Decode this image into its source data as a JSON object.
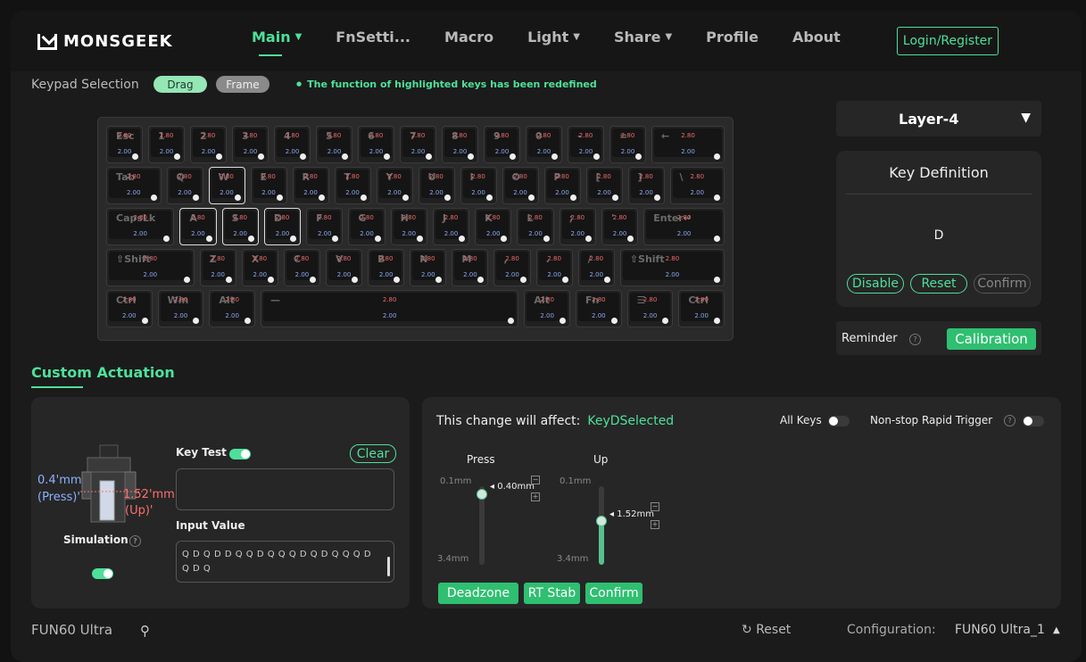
{
  "brand": "MONSGEEK",
  "nav": [
    {
      "label": "Main",
      "active": true,
      "caret": true
    },
    {
      "label": "FnSetti...",
      "active": false,
      "caret": false
    },
    {
      "label": "Macro",
      "active": false,
      "caret": false
    },
    {
      "label": "Light",
      "active": false,
      "caret": true
    },
    {
      "label": "Share",
      "active": false,
      "caret": true
    },
    {
      "label": "Profile",
      "active": false,
      "caret": false
    },
    {
      "label": "About",
      "active": false,
      "caret": false
    }
  ],
  "login_label": "Login/Register",
  "keypad": {
    "label": "Keypad Selection",
    "drag": "Drag",
    "frame": "Frame",
    "notice": "The function of highlighted keys has been redefined"
  },
  "keyboard_rows": [
    [
      {
        "l": "Esc",
        "t": "2.80",
        "b": "2.00"
      },
      {
        "l": "1",
        "t": "2.80",
        "b": "2.00"
      },
      {
        "l": "2",
        "t": "2.80",
        "b": "2.00"
      },
      {
        "l": "3",
        "t": "2.80",
        "b": "2.00"
      },
      {
        "l": "4",
        "t": "2.80",
        "b": "2.00"
      },
      {
        "l": "5",
        "t": "2.80",
        "b": "2.00"
      },
      {
        "l": "6",
        "t": "2.80",
        "b": "2.00"
      },
      {
        "l": "7",
        "t": "2.80",
        "b": "2.00"
      },
      {
        "l": "8",
        "t": "2.80",
        "b": "2.00"
      },
      {
        "l": "9",
        "t": "2.80",
        "b": "2.00"
      },
      {
        "l": "0",
        "t": "2.80",
        "b": "2.00"
      },
      {
        "l": "-",
        "t": "2.80",
        "b": "2.00"
      },
      {
        "l": "=",
        "t": "2.80",
        "b": "2.00"
      },
      {
        "l": "←",
        "t": "2.80",
        "b": "2.00"
      }
    ],
    [
      {
        "l": "Tab",
        "t": "2.80",
        "b": "2.00"
      },
      {
        "l": "Q",
        "t": "2.80",
        "b": "2.00"
      },
      {
        "l": "W",
        "t": "2.80",
        "b": "2.00",
        "sel": true
      },
      {
        "l": "E",
        "t": "2.80",
        "b": "2.00"
      },
      {
        "l": "R",
        "t": "2.80",
        "b": "2.00"
      },
      {
        "l": "T",
        "t": "2.80",
        "b": "2.00"
      },
      {
        "l": "Y",
        "t": "2.80",
        "b": "2.00"
      },
      {
        "l": "U",
        "t": "2.80",
        "b": "2.00"
      },
      {
        "l": "I",
        "t": "2.80",
        "b": "2.00"
      },
      {
        "l": "O",
        "t": "2.80",
        "b": "2.00"
      },
      {
        "l": "P",
        "t": "2.80",
        "b": "2.00"
      },
      {
        "l": "[",
        "t": "2.80",
        "b": "2.00"
      },
      {
        "l": "]",
        "t": "2.80",
        "b": "2.00"
      },
      {
        "l": "\\",
        "t": "2.80",
        "b": "2.00"
      }
    ],
    [
      {
        "l": "CapsLk",
        "t": "2.80",
        "b": "2.00"
      },
      {
        "l": "A",
        "t": "2.80",
        "b": "2.00",
        "sel": true
      },
      {
        "l": "S",
        "t": "2.80",
        "b": "2.00",
        "sel": true
      },
      {
        "l": "D",
        "t": "2.80",
        "b": "2.00",
        "sel": true
      },
      {
        "l": "F",
        "t": "2.80",
        "b": "2.00"
      },
      {
        "l": "G",
        "t": "2.80",
        "b": "2.00"
      },
      {
        "l": "H",
        "t": "2.80",
        "b": "2.00"
      },
      {
        "l": "J",
        "t": "2.80",
        "b": "2.00"
      },
      {
        "l": "K",
        "t": "2.80",
        "b": "2.00"
      },
      {
        "l": "L",
        "t": "2.80",
        "b": "2.00"
      },
      {
        "l": ";",
        "t": "2.80",
        "b": "2.00"
      },
      {
        "l": "'",
        "t": "2.80",
        "b": "2.00"
      },
      {
        "l": "Enter↵",
        "t": "2.80",
        "b": "2.00"
      }
    ],
    [
      {
        "l": "⇧Shift",
        "t": "2.80",
        "b": "2.00"
      },
      {
        "l": "Z",
        "t": "2.80",
        "b": "2.00"
      },
      {
        "l": "X",
        "t": "2.80",
        "b": "2.00"
      },
      {
        "l": "C",
        "t": "2.80",
        "b": "2.00"
      },
      {
        "l": "V",
        "t": "2.80",
        "b": "2.00"
      },
      {
        "l": "B",
        "t": "2.80",
        "b": "2.00"
      },
      {
        "l": "N",
        "t": "2.80",
        "b": "2.00"
      },
      {
        "l": "M",
        "t": "2.80",
        "b": "2.00"
      },
      {
        "l": ",",
        "t": "2.80",
        "b": "2.00"
      },
      {
        "l": ".",
        "t": "2.80",
        "b": "2.00"
      },
      {
        "l": "/",
        "t": "2.80",
        "b": "2.00"
      },
      {
        "l": "⇧Shift",
        "t": "2.80",
        "b": "2.00"
      }
    ],
    [
      {
        "l": "Ctrl",
        "t": "2.80",
        "b": "2.00"
      },
      {
        "l": "Win",
        "t": "2.80",
        "b": "2.00"
      },
      {
        "l": "Alt",
        "t": "2.80",
        "b": "2.00"
      },
      {
        "l": "—",
        "t": "2.80",
        "b": "2.00"
      },
      {
        "l": "Alt",
        "t": "2.80",
        "b": "2.00"
      },
      {
        "l": "Fn",
        "t": "2.80",
        "b": "2.00"
      },
      {
        "l": "☰",
        "t": "2.80",
        "b": "2.00"
      },
      {
        "l": "Ctrl",
        "t": "2.80",
        "b": "2.00"
      }
    ]
  ],
  "layer_label": "Layer-4",
  "key_definition": {
    "title": "Key Definition",
    "value": "D",
    "disable": "Disable",
    "reset": "Reset",
    "confirm": "Confirm"
  },
  "reminder": {
    "label": "Reminder",
    "calibration": "Calibration"
  },
  "custom_actuation": {
    "title": "Custom Actuation",
    "press_value": "0.4'mm",
    "press_label": "(Press)'",
    "up_value": "1.52'mm",
    "up_label": "(Up)'",
    "simulation": "Simulation",
    "key_test": "Key Test",
    "clear": "Clear",
    "input_value_label": "Input Value",
    "input_value": "Q D Q D D Q Q D Q Q Q D Q D Q Q Q D Q D Q"
  },
  "affect": {
    "label": "This change will affect:",
    "target": "KeyDSelected",
    "all_keys": "All Keys",
    "nonstop": "Non-stop Rapid Trigger",
    "press": {
      "title": "Press",
      "min": "0.1mm",
      "max": "3.4mm",
      "value": "0.40mm",
      "level": 0.09
    },
    "up": {
      "title": "Up",
      "min": "0.1mm",
      "max": "3.4mm",
      "value": "1.52mm",
      "level": 0.43
    },
    "buttons": [
      "Deadzone",
      "RT Stab",
      "Confirm"
    ]
  },
  "footer": {
    "model": "FUN60 Ultra",
    "reset": "Reset",
    "config_label": "Configuration:",
    "config_value": "FUN60 Ultra_1"
  }
}
